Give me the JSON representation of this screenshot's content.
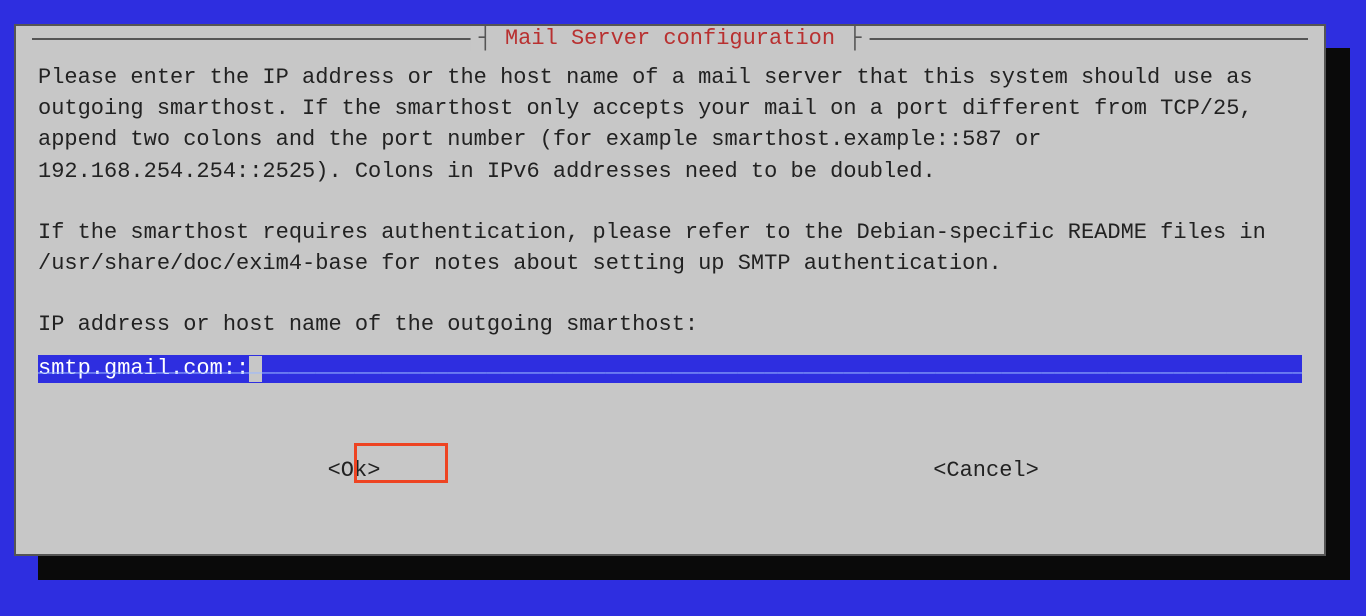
{
  "dialog": {
    "title": "Mail Server configuration",
    "paragraph1": "Please enter the IP address or the host name of a mail server that this system should use as outgoing smarthost. If the smarthost only accepts your mail on a port different from TCP/25, append two colons and the port number (for example smarthost.example::587 or 192.168.254.254::2525). Colons in IPv6 addresses need to be doubled.",
    "paragraph2": "If the smarthost requires authentication, please refer to the Debian-specific README files in /usr/share/doc/exim4-base for notes about setting up SMTP authentication.",
    "prompt": "IP address or host name of the outgoing smarthost:",
    "input_value": "smtp.gmail.com::",
    "buttons": {
      "ok": "<Ok>",
      "cancel": "<Cancel>"
    }
  }
}
